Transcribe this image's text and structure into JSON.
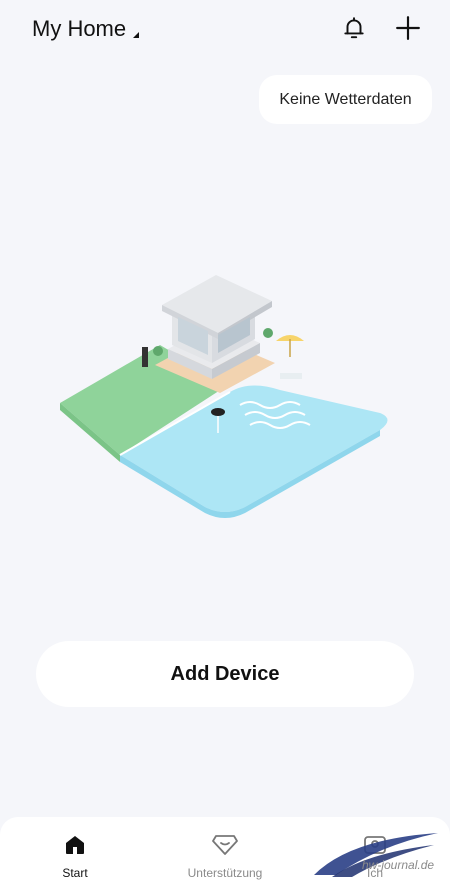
{
  "header": {
    "home_name": "My Home",
    "icons": [
      "caret-down-icon",
      "bell-icon",
      "plus-icon"
    ]
  },
  "weather": {
    "label": "Keine Wetterdaten"
  },
  "main": {
    "add_device_label": "Add Device"
  },
  "tabbar": {
    "tabs": [
      {
        "label": "Start",
        "icon": "home-icon",
        "active": true
      },
      {
        "label": "Unterstützung",
        "icon": "diamond-icon",
        "active": false
      },
      {
        "label": "Ich",
        "icon": "profile-icon",
        "active": false
      }
    ]
  },
  "watermark": {
    "text": "hw-journal.de"
  },
  "colors": {
    "background": "#f5f6fa",
    "card": "#ffffff",
    "lawn": "#8fd39a",
    "pool": "#ade6f5",
    "text": "#111111",
    "muted": "#8a8a8a"
  }
}
